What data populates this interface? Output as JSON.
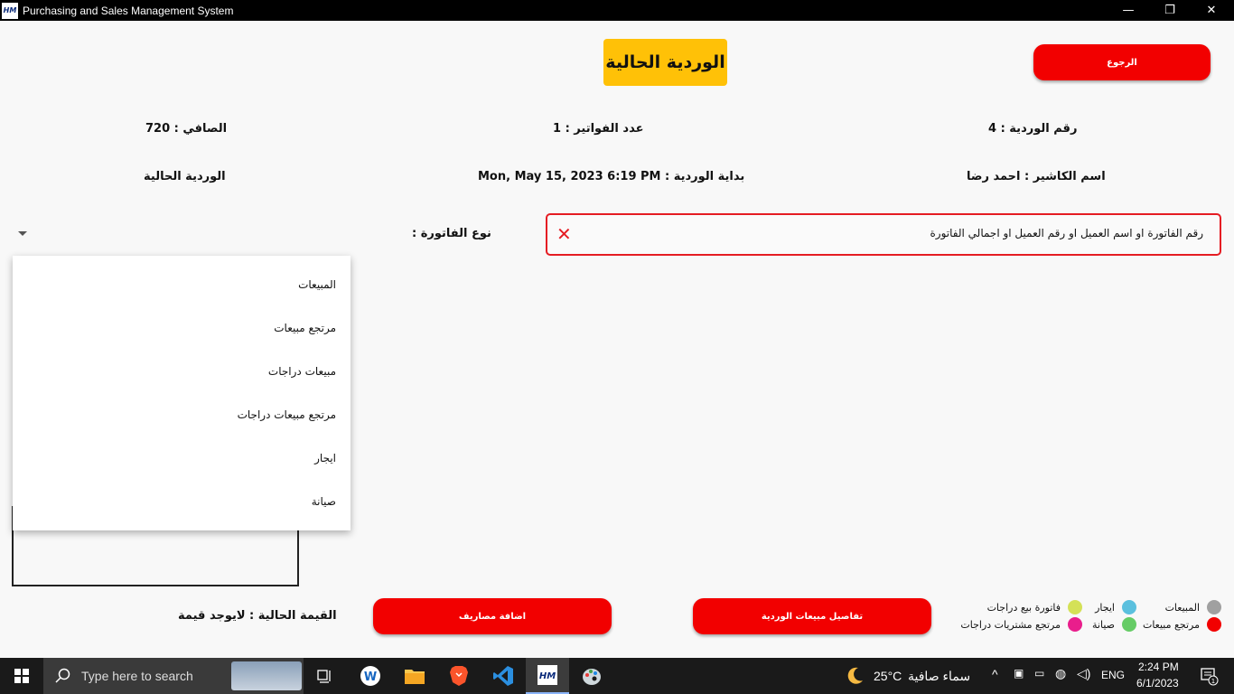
{
  "window": {
    "title": "Purchasing and Sales Management System",
    "logo_text": "HM",
    "minimize": "—",
    "restore": "❐",
    "close": "✕"
  },
  "header": {
    "title": "الوردية الحالية",
    "back_label": "الرجوع"
  },
  "info": {
    "shift_number": "رقم  الوردية : 4",
    "invoice_count": "عدد الفواتير : 1",
    "net": "الصافي : 720",
    "cashier_name": "اسم الكاشير : احمد رضا",
    "shift_start": "بداية الوردية :  Mon, May 15, 2023  6:19 PM",
    "shift_status": "الوردية الحالية"
  },
  "search": {
    "placeholder": "رقم الفاتورة  او  اسم العميل  او  رقم العميل  او  اجمالي الفاتورة",
    "clear_icon": "✕"
  },
  "invoice_type": {
    "label": "نوع الفاتورة :",
    "options": [
      "المبيعات",
      "مرتجع مبيعات",
      "مبيعات دراجات",
      "مرتجع مبيعات دراجات",
      "ايجار",
      "صيانة"
    ]
  },
  "footer": {
    "current_value": "القيمة الحالية  :  لايوجد قيمة",
    "add_expenses": "اضافة مصاريف",
    "shift_sales_details": "تفاصيل مبيعات الوردية"
  },
  "legend": [
    {
      "label": "المبيعات",
      "color": "#a0a0a0"
    },
    {
      "label": "ايجار",
      "color": "#5bc0de"
    },
    {
      "label": "فاتورة بيع دراجات",
      "color": "#d4e157"
    },
    {
      "label": "مرتجع مبيعات",
      "color": "#f20000"
    },
    {
      "label": "صيانة",
      "color": "#66cc66"
    },
    {
      "label": "مرتجع مشتريات دراجات",
      "color": "#e91e8c"
    }
  ],
  "taskbar": {
    "search_placeholder": "Type here to search",
    "weather_temp": "25°C",
    "weather_desc": "سماء صافية",
    "language": "ENG",
    "time": "2:24 PM",
    "date": "6/1/2023",
    "notification_count": "1"
  }
}
